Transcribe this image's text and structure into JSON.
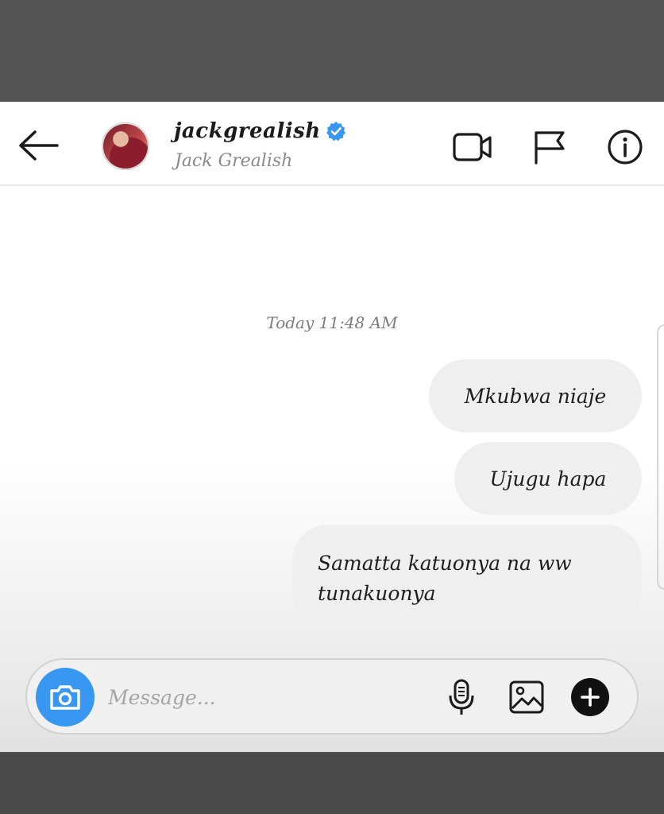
{
  "header": {
    "username": "jackgrealish",
    "full_name": "Jack Grealish",
    "verified": true
  },
  "thread": {
    "timestamp": "Today 11:48 AM",
    "messages": [
      {
        "text": "Mkubwa niaje",
        "sender": "me"
      },
      {
        "text": "Ujugu hapa",
        "sender": "me"
      },
      {
        "text": "Samatta katuonya na ww tunakuonya",
        "sender": "me"
      }
    ]
  },
  "composer": {
    "placeholder": "Message..."
  },
  "icons": {
    "back": "arrow-left-icon",
    "video": "video-camera-icon",
    "flag": "flag-icon",
    "info": "info-icon",
    "camera": "camera-icon",
    "mic": "microphone-icon",
    "gallery": "image-icon",
    "plus": "plus-circle-icon"
  },
  "colors": {
    "accent": "#3897f0",
    "bubble": "#efefef",
    "verified": "#3897f0"
  }
}
